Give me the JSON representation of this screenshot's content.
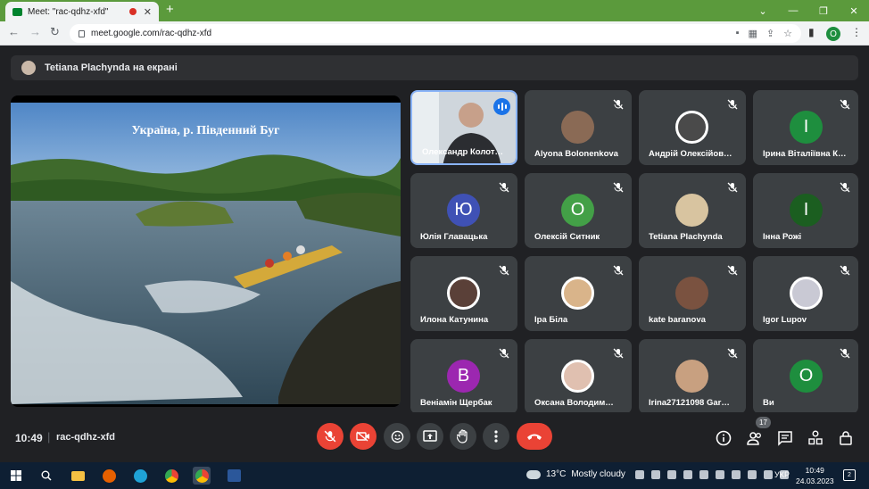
{
  "browser": {
    "tab_title": "Meet: \"rac-qdhz-xfd\"",
    "tab_close": "✕",
    "new_tab": "+",
    "url": "meet.google.com/rac-qdhz-xfd",
    "profile_initial": "O",
    "window_controls": [
      "⌄",
      "—",
      "❐",
      "✕"
    ]
  },
  "meet": {
    "presenter_banner": "Tetiana Plachynda на екрані",
    "slide_title": "Україна, р. Південний Буг",
    "time": "10:49",
    "meeting_code": "rac-qdhz-xfd",
    "participant_count": "17"
  },
  "participants": [
    {
      "name": "Олександр Колот…",
      "avatar": "video",
      "muted": false,
      "speaking": true
    },
    {
      "name": "Alyona Bolonenkova",
      "avatar": "photo",
      "color": "#8a6a55",
      "muted": true
    },
    {
      "name": "Андрій Олексійов…",
      "avatar": "photo",
      "color": "#4a4a4a",
      "muted": true
    },
    {
      "name": "Ірина Віталіївна К…",
      "avatar": "letter",
      "letter": "І",
      "color": "#1e8e3e",
      "muted": true
    },
    {
      "name": "Юлія Главацька",
      "avatar": "letter",
      "letter": "Ю",
      "color": "#3f51b5",
      "muted": true
    },
    {
      "name": "Олексій Ситник",
      "avatar": "letter",
      "letter": "О",
      "color": "#43a047",
      "muted": true
    },
    {
      "name": "Tetiana Plachynda",
      "avatar": "photo",
      "color": "#d8c4a0",
      "muted": true
    },
    {
      "name": "Інна Рожі",
      "avatar": "letter",
      "letter": "І",
      "color": "#1b5e20",
      "muted": true
    },
    {
      "name": "Илона Катунина",
      "avatar": "photo",
      "color": "#5a4038",
      "muted": true
    },
    {
      "name": "Іра Біла",
      "avatar": "photo",
      "color": "#d9b48a",
      "muted": true
    },
    {
      "name": "kate baranova",
      "avatar": "photo",
      "color": "#7a5240",
      "muted": true
    },
    {
      "name": "Igor Lupov",
      "avatar": "photo",
      "color": "#c9c9d4",
      "muted": true
    },
    {
      "name": "Веніамін Щербак",
      "avatar": "letter",
      "letter": "В",
      "color": "#9c27b0",
      "muted": true
    },
    {
      "name": "Оксана Володим…",
      "avatar": "photo",
      "color": "#e0c0b0",
      "muted": true
    },
    {
      "name": "Irina27121098 Gar…",
      "avatar": "photo",
      "color": "#c8a080",
      "muted": true
    },
    {
      "name": "Ви",
      "avatar": "letter",
      "letter": "О",
      "color": "#1e8e3e",
      "muted": true
    }
  ],
  "taskbar": {
    "temperature": "13°C",
    "weather": "Mostly cloudy",
    "language": "УКР",
    "time": "10:49",
    "date": "24.03.2023",
    "notifications": "2"
  }
}
